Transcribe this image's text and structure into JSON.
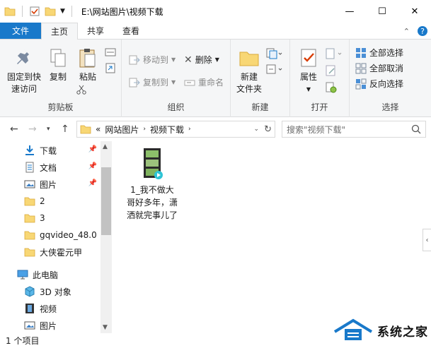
{
  "titlebar": {
    "path": "E:\\网站图片\\视频下载",
    "minimize": "—",
    "maximize": "☐",
    "close": "✕"
  },
  "tabs": {
    "file": "文件",
    "home": "主页",
    "share": "共享",
    "view": "查看"
  },
  "ribbon": {
    "clipboard": {
      "label": "剪贴板",
      "pin": "固定到快",
      "pin2": "速访问",
      "copy": "复制",
      "paste": "粘贴"
    },
    "organize": {
      "label": "组织",
      "move_to": "移动到",
      "copy_to": "复制到",
      "delete": "删除",
      "rename": "重命名"
    },
    "new": {
      "label": "新建",
      "new_folder": "新建",
      "new_folder2": "文件夹"
    },
    "open": {
      "label": "打开",
      "properties": "属性"
    },
    "select": {
      "label": "选择",
      "select_all": "全部选择",
      "select_none": "全部取消",
      "invert": "反向选择"
    }
  },
  "address": {
    "crumb_prefix": "«",
    "crumbs": [
      "网站图片",
      "视频下载"
    ],
    "search_placeholder": "搜索\"视频下载\""
  },
  "nav": {
    "items": [
      {
        "label": "下载",
        "icon": "download-icon",
        "pinned": true
      },
      {
        "label": "文档",
        "icon": "document-icon",
        "pinned": true
      },
      {
        "label": "图片",
        "icon": "pictures-icon",
        "pinned": true
      },
      {
        "label": "2",
        "icon": "folder-icon"
      },
      {
        "label": "3",
        "icon": "folder-icon"
      },
      {
        "label": "gqvideo_48.0",
        "icon": "folder-icon"
      },
      {
        "label": "大侠霍元甲",
        "icon": "folder-icon"
      },
      {
        "label": "此电脑",
        "icon": "computer-icon"
      },
      {
        "label": "3D 对象",
        "icon": "3d-objects-icon"
      },
      {
        "label": "视频",
        "icon": "videos-icon"
      },
      {
        "label": "图片",
        "icon": "pictures-icon"
      }
    ]
  },
  "content": {
    "files": [
      {
        "name": "1_我不做大哥好多年，潇洒就完事儿了",
        "type": "video"
      }
    ]
  },
  "status": {
    "count": "1 个项目"
  },
  "watermark": {
    "text": "系统之家"
  },
  "colors": {
    "accent": "#1979ca",
    "folder": "#f8d775",
    "ribbon_bg": "#f5f6f7"
  }
}
